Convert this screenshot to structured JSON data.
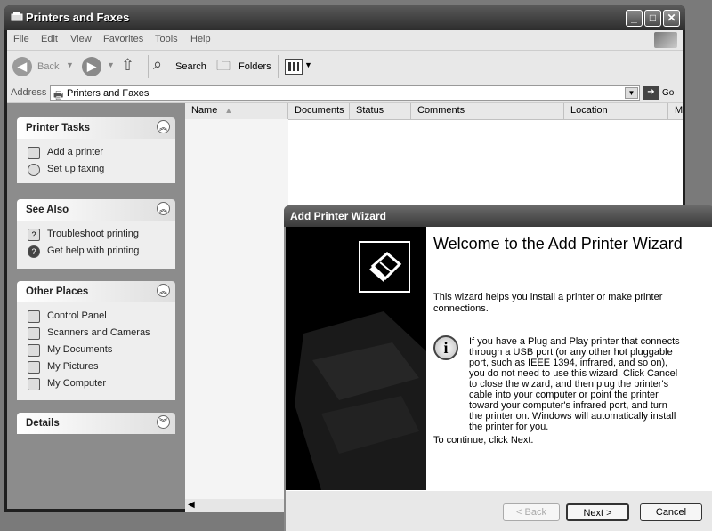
{
  "window": {
    "title": "Printers and Faxes"
  },
  "menu": [
    "File",
    "Edit",
    "View",
    "Favorites",
    "Tools",
    "Help"
  ],
  "toolbar": {
    "back": "Back",
    "search": "Search",
    "folders": "Folders"
  },
  "address": {
    "label": "Address",
    "value": "Printers and Faxes",
    "go": "Go"
  },
  "panels": {
    "printer_tasks": {
      "title": "Printer Tasks",
      "items": [
        "Add a printer",
        "Set up faxing"
      ]
    },
    "see_also": {
      "title": "See Also",
      "items": [
        "Troubleshoot printing",
        "Get help with printing"
      ]
    },
    "other_places": {
      "title": "Other Places",
      "items": [
        "Control Panel",
        "Scanners and Cameras",
        "My Documents",
        "My Pictures",
        "My Computer"
      ]
    },
    "details": {
      "title": "Details"
    }
  },
  "columns": [
    "Name",
    "Documents",
    "Status",
    "Comments",
    "Location",
    "M"
  ],
  "wizard": {
    "title": "Add Printer Wizard",
    "heading": "Welcome to the Add Printer Wizard",
    "intro": "This wizard helps you install a printer or make printer connections.",
    "info": "If you have a Plug and Play printer that connects through a USB port (or any other hot pluggable port, such as IEEE 1394, infrared, and so on), you do not need to use this wizard. Click Cancel to close the wizard, and then plug the printer's cable into your computer or point the printer toward your computer's infrared port, and turn the printer on. Windows will automatically install the printer for you.",
    "continue": "To continue, click Next.",
    "buttons": {
      "back": "< Back",
      "next": "Next >",
      "cancel": "Cancel"
    }
  }
}
